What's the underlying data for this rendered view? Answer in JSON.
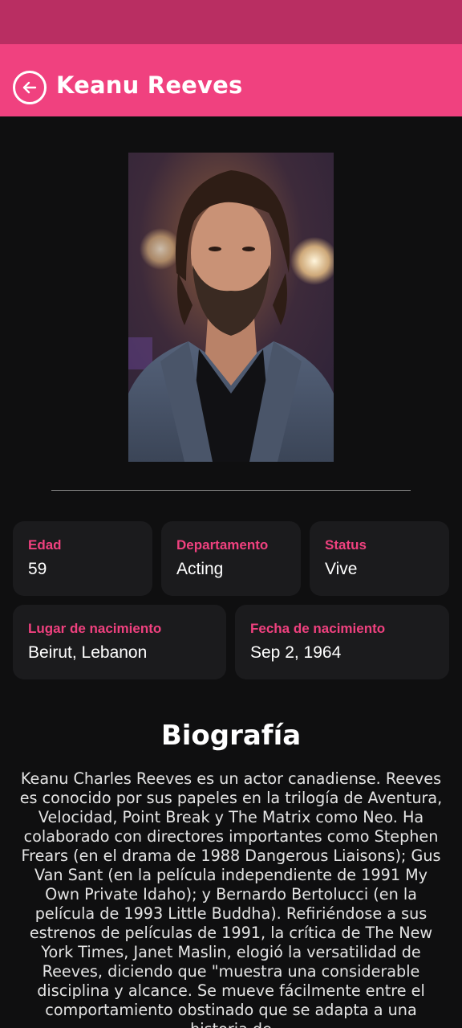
{
  "header": {
    "title": "Keanu Reeves"
  },
  "info_cards": [
    {
      "label": "Edad",
      "value": "59"
    },
    {
      "label": "Departamento",
      "value": "Acting"
    },
    {
      "label": "Status",
      "value": "Vive"
    },
    {
      "label": "Lugar de nacimiento",
      "value": "Beirut, Lebanon"
    },
    {
      "label": "Fecha de nacimiento",
      "value": "Sep 2, 1964"
    }
  ],
  "biography": {
    "title": "Biografía",
    "text": "Keanu Charles Reeves es un actor canadiense. Reeves es conocido por sus papeles en la trilogía de Aventura, Velocidad, Point Break y The Matrix como Neo. Ha colaborado con directores importantes como Stephen Frears (en el drama de 1988 Dangerous Liaisons); Gus Van Sant (en la película independiente de 1991 My Own Private Idaho); y Bernardo Bertolucci (en la película de 1993 Little Buddha). Refiriéndose a sus estrenos de películas de 1991, la crítica de The New York Times, Janet Maslin, elogió la versatilidad de Reeves, diciendo que \"muestra una considerable disciplina y alcance. Se mueve fácilmente entre el comportamiento obstinado que se adapta a una historia de"
  },
  "colors": {
    "status_bar": "#b92e62",
    "app_bar": "#f0417f",
    "accent": "#f0417f",
    "background": "#0f0f10",
    "card": "#1b1b1d"
  },
  "icons": {
    "back": "arrow-left-circle-icon"
  }
}
